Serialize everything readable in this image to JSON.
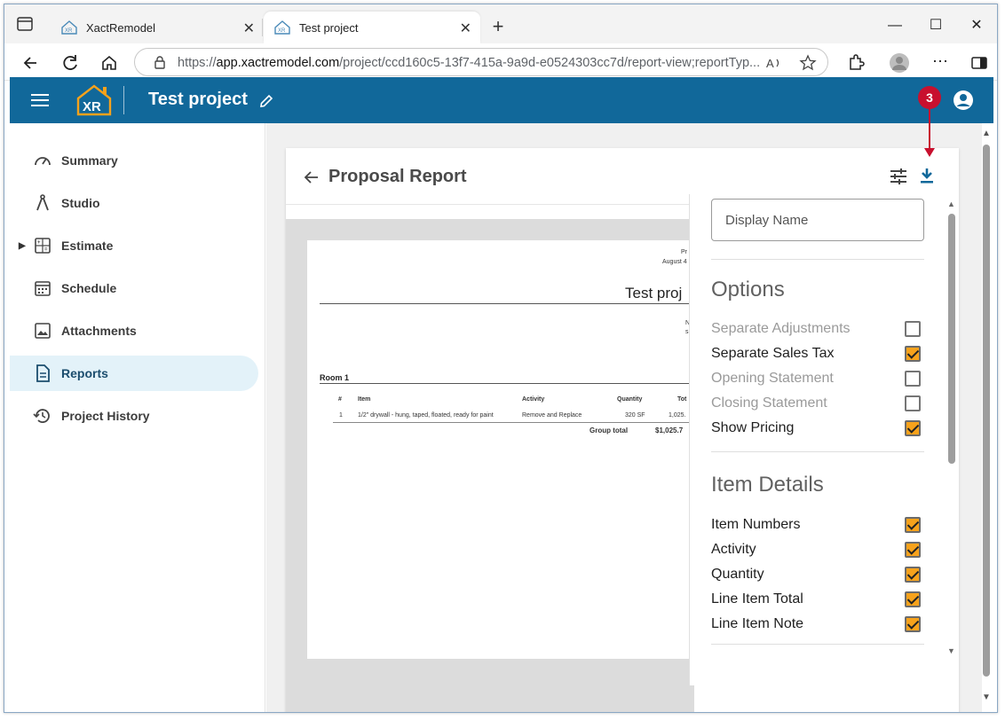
{
  "browser": {
    "tabs": [
      {
        "label": "XactRemodel"
      },
      {
        "label": "Test project"
      }
    ],
    "url_prefix": "https://",
    "url_domain": "app.xactremodel.com",
    "url_rest": "/project/ccd160c5-13f7-415a-9a9d-e0524303cc7d/report-view;reportTyp..."
  },
  "header": {
    "project_title": "Test project"
  },
  "sidebar": {
    "items": [
      {
        "label": "Summary"
      },
      {
        "label": "Studio"
      },
      {
        "label": "Estimate"
      },
      {
        "label": "Schedule"
      },
      {
        "label": "Attachments"
      },
      {
        "label": "Reports"
      },
      {
        "label": "Project History"
      }
    ]
  },
  "report": {
    "title": "Proposal Report"
  },
  "preview": {
    "top_right_1": "Pr",
    "top_right_2": "August 4",
    "doc_title": "Test proj",
    "right_a": "N",
    "right_b": "s",
    "room": "Room 1",
    "headers": [
      "#",
      "Item",
      "Activity",
      "Quantity",
      "Tot"
    ],
    "row": [
      "1",
      "1/2\" drywall - hung, taped, floated, ready for paint",
      "Remove and Replace",
      "320 SF",
      "1,025."
    ],
    "group_total_label": "Group total",
    "group_total_value": "$1,025.7"
  },
  "panel": {
    "display_name_placeholder": "Display Name",
    "options_title": "Options",
    "options": [
      {
        "label": "Separate Adjustments",
        "checked": false
      },
      {
        "label": "Separate Sales Tax",
        "checked": true
      },
      {
        "label": "Opening Statement",
        "checked": false
      },
      {
        "label": "Closing Statement",
        "checked": false
      },
      {
        "label": "Show Pricing",
        "checked": true
      }
    ],
    "item_details_title": "Item Details",
    "item_details": [
      {
        "label": "Item Numbers",
        "checked": true
      },
      {
        "label": "Activity",
        "checked": true
      },
      {
        "label": "Quantity",
        "checked": true
      },
      {
        "label": "Line Item Total",
        "checked": true
      },
      {
        "label": "Line Item Note",
        "checked": true
      }
    ]
  },
  "annotation": {
    "step": "3"
  },
  "colors": {
    "appbar": "#11689a",
    "checkbox_on": "#f7a21b",
    "callout": "#c8102e",
    "active_nav": "#e3f2f9"
  }
}
